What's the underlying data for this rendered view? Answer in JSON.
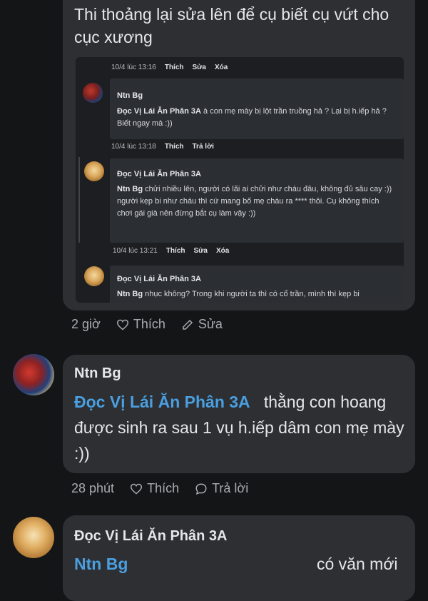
{
  "comment1": {
    "text": "Thi thoảng lại sửa lên để cụ biết cụ vứt cho cục xương",
    "time": "2 giờ",
    "like": "Thích",
    "edit": "Sửa"
  },
  "screenshot": {
    "meta1": {
      "time": "10/4 lúc 13:16",
      "like": "Thích",
      "a": "Sửa",
      "b": "Xóa"
    },
    "c1": {
      "name": "Ntn Bg",
      "mention": "Đọc Vị Lái Ăn Phân 3A",
      "text": " à con mẹ mày bị lột trần truồng hả ? Lại bị h.iếp hả ? Biết ngay mà :))"
    },
    "meta2": {
      "time": "10/4 lúc 13:18",
      "like": "Thích",
      "a": "Trả lời"
    },
    "c2": {
      "name": "Đọc Vị Lái Ăn Phân 3A",
      "mention": "Ntn Bg",
      "text1": " chửi nhiều lên, người có lãi ai chửi như cháu đâu, không đủ sâu cay :))",
      "text2": "người kẹp bi như cháu thì cứ mang bố mẹ cháu ra **** thôi. Cụ không thích chơi gái già nên đừng bắt cụ làm vậy :))"
    },
    "meta3": {
      "time": "10/4 lúc 13:21",
      "like": "Thích",
      "a": "Sửa",
      "b": "Xóa"
    },
    "c3": {
      "name": "Đọc Vị Lái Ăn Phân 3A",
      "mention": "Ntn Bg",
      "text": " nhục không? Trong khi người ta thì có cổ trần, mình thì kẹp bi"
    }
  },
  "comment2": {
    "name": "Ntn Bg",
    "mention": "Đọc Vị Lái Ăn Phân 3A",
    "text": "thằng con hoang được sinh ra sau 1 vụ h.iếp dâm con mẹ mày :))",
    "time": "28 phút",
    "like": "Thích",
    "reply": "Trả lời"
  },
  "comment3": {
    "name": "Đọc Vị Lái Ăn Phân 3A",
    "mention": "Ntn Bg",
    "text": "có văn mới"
  },
  "colors": {
    "background": "#141517",
    "bubble": "#2d2f33",
    "mention": "#4a9fe0"
  }
}
